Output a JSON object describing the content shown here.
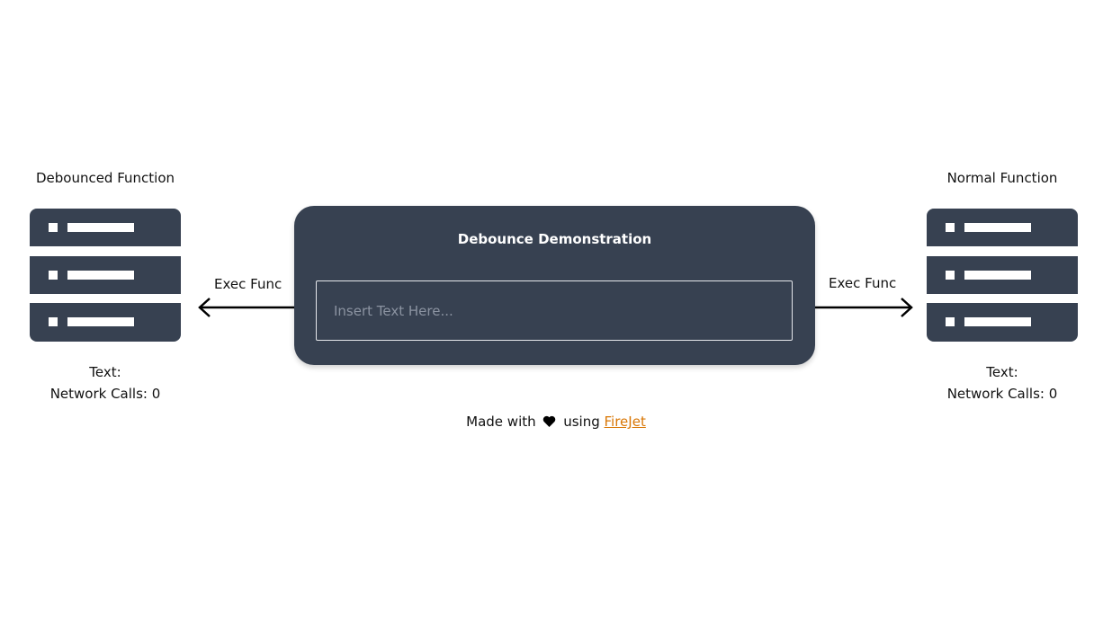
{
  "left": {
    "title": "Debounced Function",
    "exec_label": "Exec Func",
    "text_label": "Text:",
    "text_value": "",
    "calls_label": "Network Calls:",
    "calls_value": "0"
  },
  "right": {
    "title": "Normal Function",
    "exec_label": "Exec Func",
    "text_label": "Text:",
    "text_value": "",
    "calls_label": "Network Calls:",
    "calls_value": "0"
  },
  "panel": {
    "title": "Debounce Demonstration",
    "input_value": "",
    "input_placeholder": "Insert Text Here..."
  },
  "footer": {
    "prefix": "Made with",
    "heart_icon": "heart-icon",
    "middle": "using",
    "link_text": "FireJet"
  },
  "colors": {
    "panel_bg": "#374151",
    "server_color": "#374151",
    "link_color": "#d97706"
  },
  "icons": {
    "server": "server-icon",
    "arrow_left": "arrow-left-icon",
    "arrow_right": "arrow-right-icon"
  }
}
